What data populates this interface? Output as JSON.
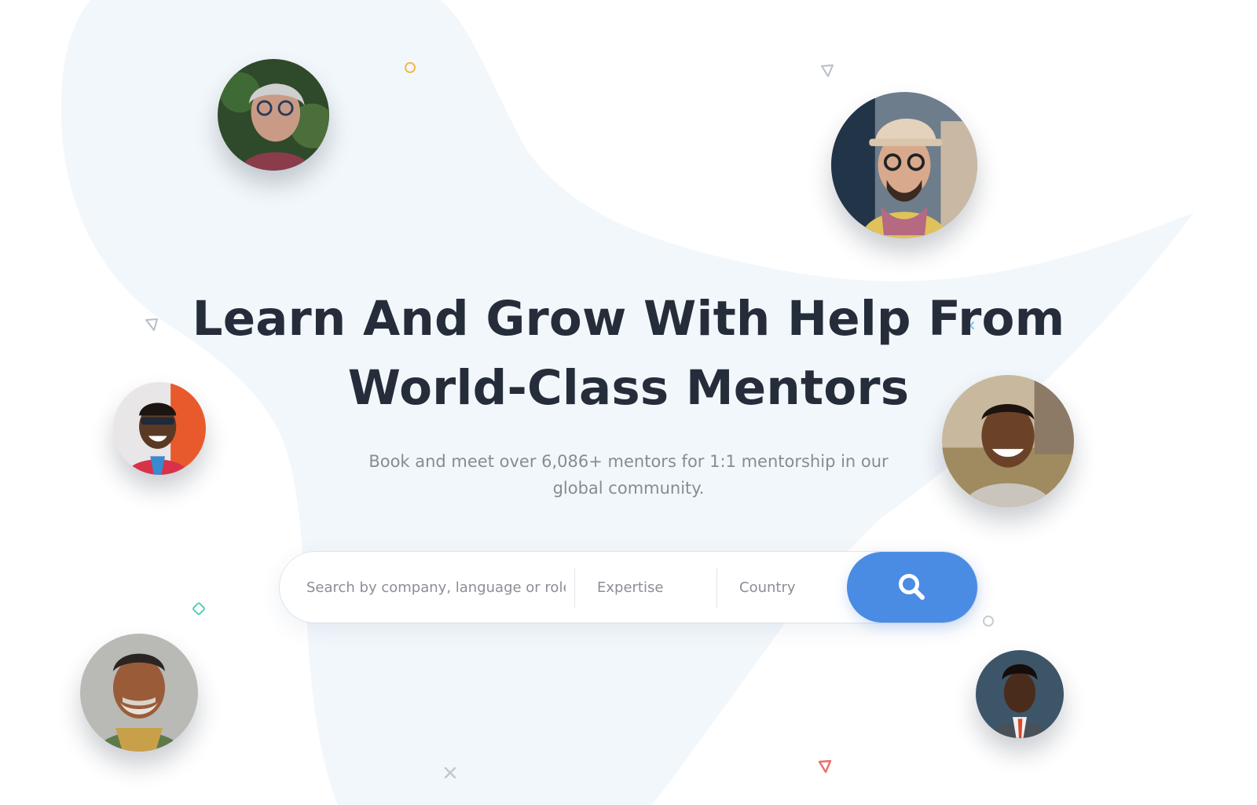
{
  "hero": {
    "headline_line1": "Learn And Grow With Help From",
    "headline_line2": "World-Class Mentors",
    "subtitle_line1": "Book and meet over 6,086+ mentors for 1:1 mentorship in our",
    "subtitle_line2": "global community."
  },
  "search": {
    "query_placeholder": "Search by company, language or role",
    "expertise_placeholder": "Expertise",
    "country_placeholder": "Country",
    "button_icon": "search-icon"
  },
  "colors": {
    "accent": "#4a8be4",
    "headline": "#262d3a",
    "subtitle": "#878b94",
    "blob": "#f2f7fb"
  },
  "avatars": [
    {
      "name": "mentor-avatar-1",
      "icon": "person-photo"
    },
    {
      "name": "mentor-avatar-2",
      "icon": "person-photo"
    },
    {
      "name": "mentor-avatar-3",
      "icon": "person-photo"
    },
    {
      "name": "mentor-avatar-4",
      "icon": "person-photo"
    },
    {
      "name": "mentor-avatar-5",
      "icon": "person-photo"
    },
    {
      "name": "mentor-avatar-6",
      "icon": "person-photo"
    }
  ]
}
